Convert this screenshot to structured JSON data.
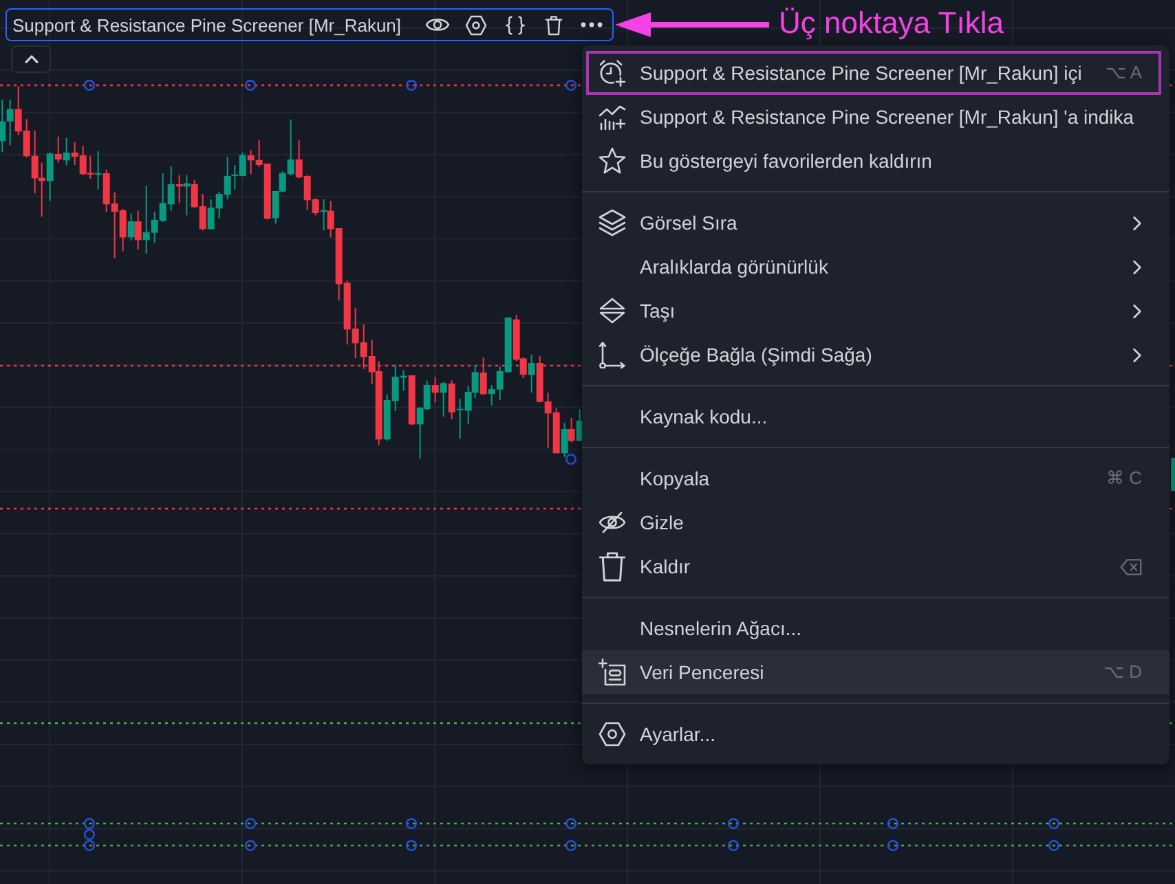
{
  "legend": {
    "title": "Support & Resistance Pine Screener [Mr_Rakun]",
    "selected": true
  },
  "annotation": {
    "text": "Üç noktaya Tıkla"
  },
  "menu": {
    "sections": [
      {
        "items": [
          {
            "label": "Support & Resistance Pine Screener [Mr_Rakun] içi",
            "shortcut": "⌥ A",
            "submenu": false,
            "hovered": false,
            "outlined": true
          },
          {
            "label": "Support & Resistance Pine Screener [Mr_Rakun] 'a indika",
            "submenu": false,
            "hovered": false,
            "outlined": false
          },
          {
            "label": "Bu göstergeyi favorilerden kaldırın",
            "submenu": false,
            "hovered": false,
            "outlined": false
          }
        ]
      },
      {
        "items": [
          {
            "label": "Görsel Sıra",
            "submenu": true,
            "hovered": false,
            "outlined": false
          },
          {
            "label": "Aralıklarda görünürlük",
            "submenu": true,
            "hovered": false,
            "outlined": false
          },
          {
            "label": "Taşı",
            "submenu": true,
            "hovered": false,
            "outlined": false
          },
          {
            "label": "Ölçeğe Bağla (Şimdi Sağa)",
            "submenu": true,
            "hovered": false,
            "outlined": false
          }
        ]
      },
      {
        "items": [
          {
            "label": "Kaynak kodu...",
            "submenu": false,
            "hovered": false,
            "outlined": false
          }
        ]
      },
      {
        "items": [
          {
            "label": "Kopyala",
            "shortcut": "⌘ C",
            "submenu": false,
            "hovered": false,
            "outlined": false
          },
          {
            "label": "Gizle",
            "submenu": false,
            "hovered": false,
            "outlined": false
          },
          {
            "label": "Kaldır",
            "submenu": false,
            "hovered": false,
            "outlined": false
          }
        ]
      },
      {
        "items": [
          {
            "label": "Nesnelerin Ağacı...",
            "submenu": false,
            "hovered": false,
            "outlined": false
          },
          {
            "label": "Veri Penceresi",
            "shortcut": "⌥ D",
            "submenu": false,
            "hovered": true,
            "outlined": false
          }
        ]
      },
      {
        "items": [
          {
            "label": "Ayarlar...",
            "submenu": false,
            "hovered": false,
            "outlined": false
          }
        ]
      }
    ]
  }
}
